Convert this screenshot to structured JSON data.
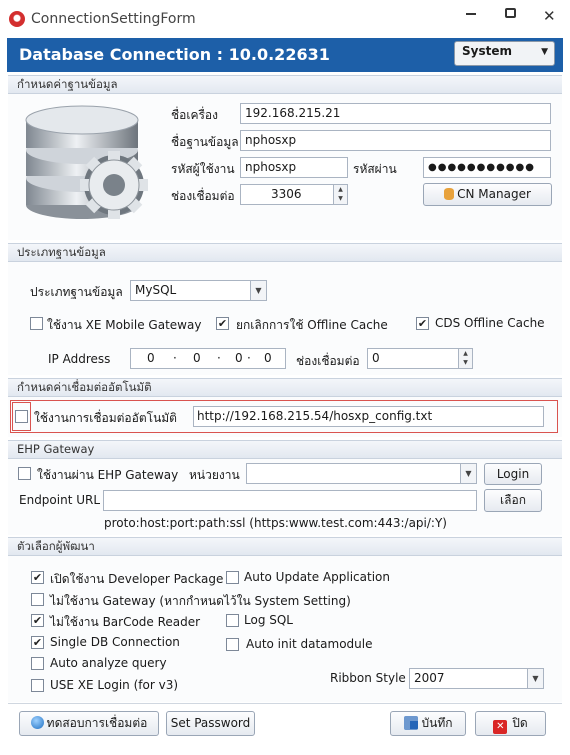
{
  "window": {
    "title": "ConnectionSettingForm"
  },
  "header": {
    "title": "Database Connection : 10.0.22631",
    "mode_select": "System"
  },
  "db_settings": {
    "section_label": "กำหนดค่าฐานข้อมูล",
    "machine_label": "ชื่อเครื่อง",
    "machine_value": "192.168.215.21",
    "dbname_label": "ชื่อฐานข้อมูล",
    "dbname_value": "nphosxp",
    "user_label": "รหัสผู้ใช้งาน",
    "user_value": "nphosxp",
    "password_label": "รหัสผ่าน",
    "password_mask": "●●●●●●●●●●●",
    "port_label": "ช่องเชื่อมต่อ",
    "port_value": "3306",
    "cn_manager_label": "CN Manager"
  },
  "db_type": {
    "section_label": "ประเภทฐานข้อมูล",
    "type_label": "ประเภทฐานข้อมูล",
    "type_value": "MySQL",
    "xe_gateway_label": "ใช้งาน XE Mobile Gateway",
    "xe_gateway_checked": false,
    "cancel_offline_label": "ยกเลิกการใช้ Offline Cache",
    "cancel_offline_checked": true,
    "cds_offline_label": "CDS Offline Cache",
    "cds_offline_checked": true,
    "ip_label": "IP Address",
    "ip_octets": [
      "0",
      "0",
      "0",
      "0"
    ],
    "port_label": "ช่องเชื่อมต่อ",
    "port_value": "0"
  },
  "auto_connect": {
    "section_label": "กำหนดค่าเชื่อมต่ออัตโนมัติ",
    "enable_label": "ใช้งานการเชื่อมต่ออัตโนมัติ",
    "enable_checked": false,
    "url_value": "http://192.168.215.54/hosxp_config.txt"
  },
  "ehp": {
    "section_label": "EHP Gateway",
    "use_label": "ใช้งานผ่าน EHP Gateway",
    "use_checked": false,
    "unit_label": "หน่วยงาน",
    "unit_value": "",
    "login_label": "Login",
    "endpoint_label": "Endpoint URL",
    "endpoint_value": "",
    "choose_label": "เลือก",
    "hint": "proto:host:port:path:ssl (https:www.test.com:443:/api/:Y)"
  },
  "dev_options": {
    "section_label": "ตัวเลือกผู้พัฒนา",
    "options": [
      {
        "label": "เปิดใช้งาน Developer Package",
        "checked": true
      },
      {
        "label": "Auto Update Application",
        "checked": false
      },
      {
        "label": "ไม่ใช้งาน Gateway (หากกำหนดไว้ใน System Setting)",
        "checked": false
      },
      {
        "label": "ไม่ใช้งาน BarCode Reader",
        "checked": true
      },
      {
        "label": "Log SQL",
        "checked": false
      },
      {
        "label": "Single DB Connection",
        "checked": true
      },
      {
        "label": "Auto init datamodule",
        "checked": false
      },
      {
        "label": "Auto analyze query",
        "checked": false
      },
      {
        "label": "USE XE Login (for v3)",
        "checked": false
      }
    ],
    "ribbon_label": "Ribbon Style",
    "ribbon_value": "2007"
  },
  "footer": {
    "test_label": "ทดสอบการเชื่อมต่อ",
    "set_password_label": "Set Password",
    "save_label": "บันทึก",
    "close_label": "ปิด"
  },
  "colors": {
    "header_bg": "#1d5fa8",
    "highlight_border": "#d9534f"
  }
}
